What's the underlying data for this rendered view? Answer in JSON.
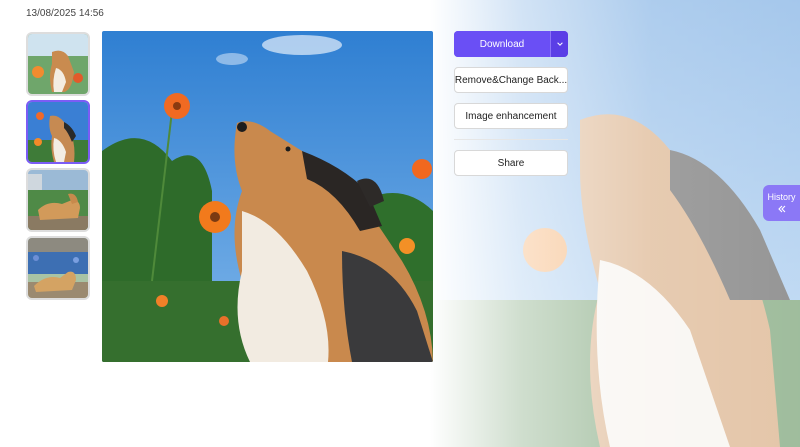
{
  "header": {
    "timestamp": "13/08/2025 14:56"
  },
  "thumbnails": [
    {
      "name": "thumbnail-dog-garden",
      "active": false
    },
    {
      "name": "thumbnail-dog-sky",
      "active": true
    },
    {
      "name": "thumbnail-dog-lying",
      "active": false
    },
    {
      "name": "thumbnail-dog-flowers",
      "active": false
    }
  ],
  "actions": {
    "download_label": "Download",
    "download_more_icon": "chevron-down-icon",
    "remove_change_bg_label": "Remove&Change Back...",
    "image_enhancement_label": "Image enhancement",
    "share_label": "Share"
  },
  "history": {
    "label": "History",
    "icon": "double-chevron-left-icon"
  },
  "colors": {
    "accent": "#6a4ff5",
    "history_tab": "#8b78f6",
    "active_thumb_border": "#7b5cf5"
  }
}
